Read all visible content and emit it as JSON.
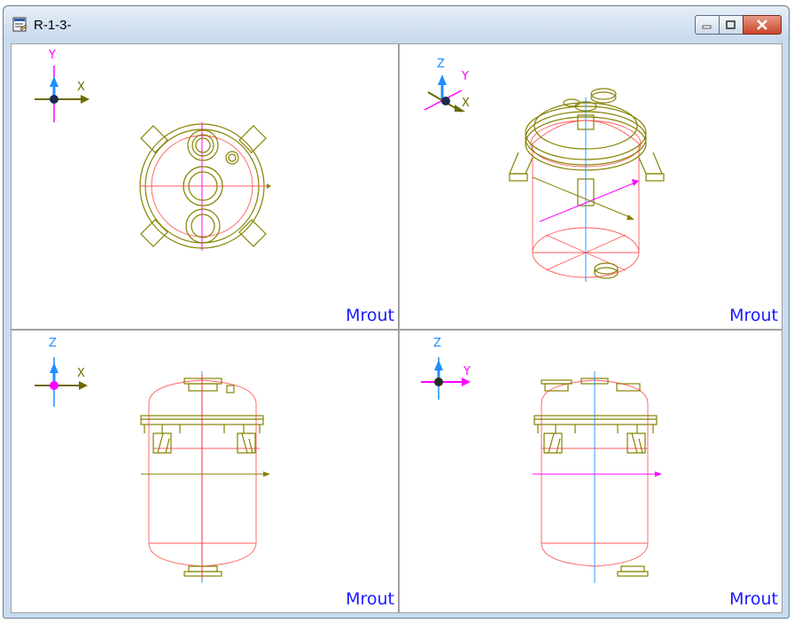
{
  "window": {
    "title": "R-1-3-",
    "controls": [
      "minimize",
      "maximize",
      "close"
    ]
  },
  "viewports": [
    {
      "id": "top",
      "label": "Mrout",
      "axis_labels": [
        "Y",
        "X"
      ]
    },
    {
      "id": "iso",
      "label": "Mrout",
      "axis_labels": [
        "Z",
        "Y",
        "X"
      ]
    },
    {
      "id": "front",
      "label": "Mrout",
      "axis_labels": [
        "Z",
        "X"
      ]
    },
    {
      "id": "side",
      "label": "Mrout",
      "axis_labels": [
        "Z",
        "Y"
      ]
    }
  ],
  "colors": {
    "outline": "#858200",
    "section": "#ff5a5a",
    "axis_x": "#6b6b00",
    "axis_y": "#ff00ff",
    "axis_z": "#1e8fff"
  }
}
